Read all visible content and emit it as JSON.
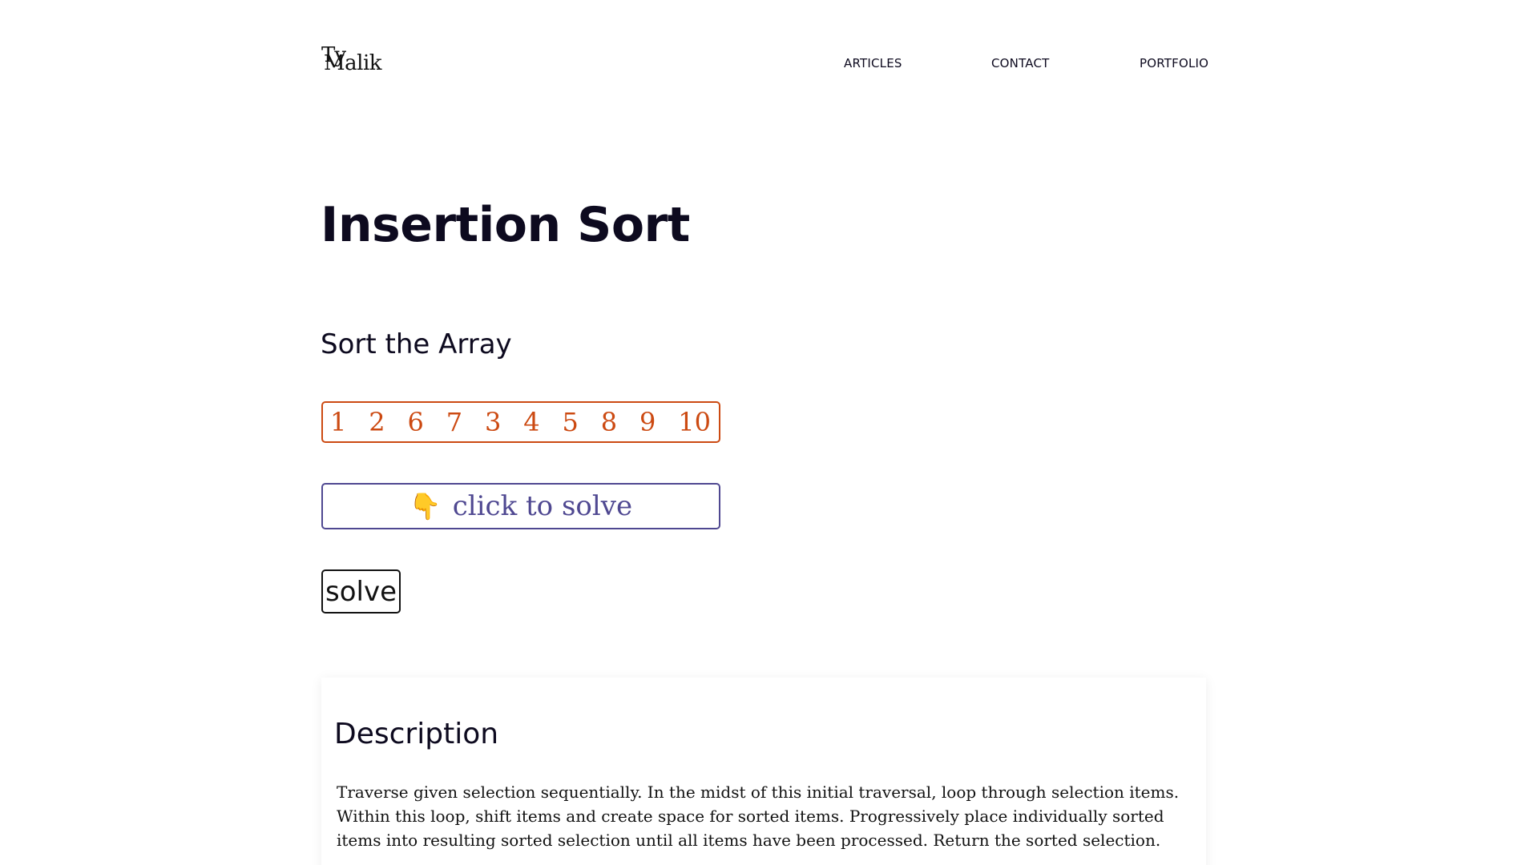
{
  "header": {
    "logo_line1": "Ty",
    "logo_line2": "Malik",
    "nav": {
      "articles": "ARTICLES",
      "contact": "CONTACT",
      "portfolio": "PORTFOLIO"
    }
  },
  "main": {
    "title": "Insertion Sort",
    "section_title": "Sort the Array",
    "array_values": [
      "1",
      "2",
      "6",
      "7",
      "3",
      "4",
      "5",
      "8",
      "9",
      "10"
    ],
    "hint_button": {
      "icon": "pointing-down-hand-icon",
      "emoji": "👇",
      "label": "click to solve"
    },
    "solve_button_label": "solve"
  },
  "description": {
    "title": "Description",
    "text": "Traverse given selection sequentially. In the midst of this initial traversal, loop through selection items. Within this loop, shift items and create space for sorted items. Progressively place individually sorted items into resulting sorted selection until all items have been processed. Return the sorted selection."
  },
  "colors": {
    "text": "#0d0a1f",
    "array_accent": "#cc4a12",
    "hint_accent": "#4f4891",
    "background": "#ffffff"
  }
}
